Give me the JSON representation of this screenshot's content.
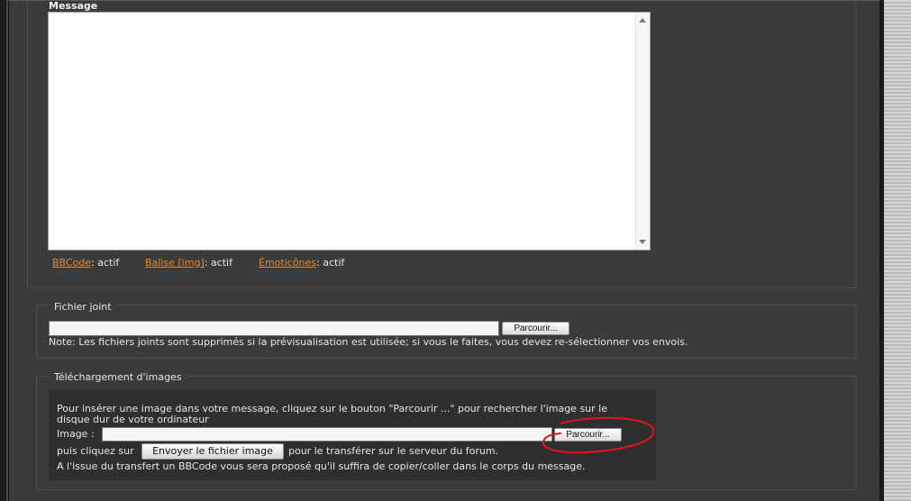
{
  "message": {
    "label": "Message",
    "textarea_value": ""
  },
  "status": {
    "bbcode_link": "BBCode",
    "bbcode_state": ": actif",
    "img_link": "Balise [img]",
    "img_state": ": actif",
    "emoticons_link": "Émoticônes",
    "emoticons_state": ": actif"
  },
  "attachment": {
    "legend": "Fichier joint",
    "browse_label": "Parcourir...",
    "note": "Note: Les fichiers joints sont supprimés si la prévisualisation est utilisée; si vous le faites, vous devez re-sélectionner vos envois."
  },
  "image_upload": {
    "legend": "Téléchargement d'images",
    "instruction_line1": "Pour insérer une image dans votre message, cliquez sur le bouton \"Parcourir ...\" pour rechercher l'image sur le",
    "instruction_line2": "disque dur de votre ordinateur",
    "image_label": "Image :",
    "browse_label": "Parcourir...",
    "then_click": "puis cliquez sur",
    "send_button": "Envoyer le fichier image",
    "after_send": "pour le transférer sur le serveur du forum.",
    "result_note": "A l'issue du transfert un BBCode vous sera proposé qu'il suffira de copier/coller dans le corps du message."
  },
  "colors": {
    "background": "#3a3c3b",
    "link": "#e8872c",
    "annotation": "#e0141e"
  }
}
